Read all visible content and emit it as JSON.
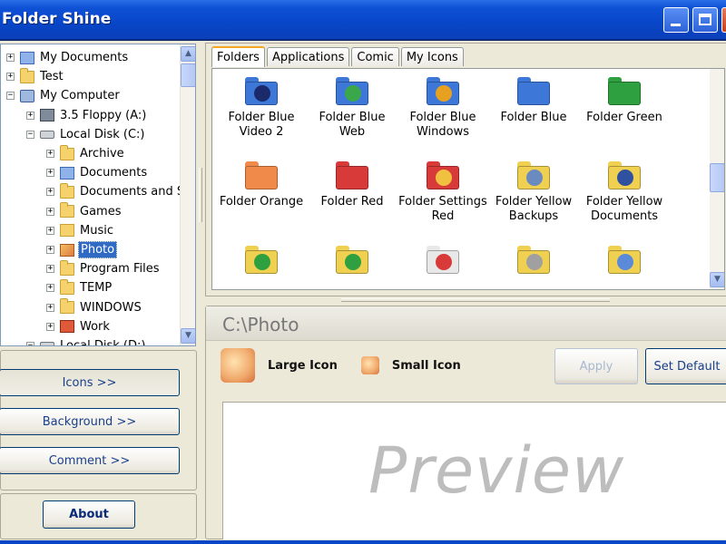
{
  "window": {
    "title": "Folder Shine",
    "minimize_icon": "minimize-icon",
    "maximize_icon": "maximize-icon",
    "close_icon": "close-icon"
  },
  "tree": {
    "items": [
      {
        "label": "My Documents",
        "icon": "documents-folder-icon",
        "expander": "+",
        "level": 0
      },
      {
        "label": "Test",
        "icon": "folder-icon",
        "expander": "+",
        "level": 0
      },
      {
        "label": "My Computer",
        "icon": "computer-icon",
        "expander": "−",
        "level": 0
      },
      {
        "label": "3.5 Floppy (A:)",
        "icon": "floppy-icon",
        "expander": "+",
        "level": 1
      },
      {
        "label": "Local Disk (C:)",
        "icon": "disk-icon",
        "expander": "−",
        "level": 1
      },
      {
        "label": "Archive",
        "icon": "folder-icon",
        "expander": "+",
        "level": 2
      },
      {
        "label": "Documents",
        "icon": "documents-folder-icon",
        "expander": "+",
        "level": 2
      },
      {
        "label": "Documents and S",
        "icon": "folder-icon",
        "expander": "+",
        "level": 2
      },
      {
        "label": "Games",
        "icon": "folder-icon",
        "expander": "+",
        "level": 2
      },
      {
        "label": "Music",
        "icon": "music-folder-icon",
        "expander": "+",
        "level": 2
      },
      {
        "label": "Photo",
        "icon": "photo-folder-icon",
        "expander": "+",
        "level": 2,
        "selected": true
      },
      {
        "label": "Program Files",
        "icon": "folder-icon",
        "expander": "+",
        "level": 2
      },
      {
        "label": "TEMP",
        "icon": "folder-icon",
        "expander": "+",
        "level": 2
      },
      {
        "label": "WINDOWS",
        "icon": "folder-icon",
        "expander": "+",
        "level": 2
      },
      {
        "label": "Work",
        "icon": "work-folder-icon",
        "expander": "+",
        "level": 2
      },
      {
        "label": "Local Disk (D:)",
        "icon": "disk-icon",
        "expander": "−",
        "level": 1
      }
    ],
    "scroll_up_glyph": "▲",
    "scroll_down_glyph": "▼"
  },
  "left_buttons": {
    "icons": "Icons >>",
    "background": "Background >>",
    "comment": "Comment >>",
    "about": "About"
  },
  "tabs": [
    "Folders",
    "Applications",
    "Comic",
    "My Icons"
  ],
  "icon_grid": [
    {
      "label": "Folder Blue Video 2",
      "lines": [
        "Folder Blue",
        "Video 2"
      ],
      "color": "#3d78d8",
      "emb": "#1a2a6a"
    },
    {
      "label": "Folder Blue Web",
      "lines": [
        "Folder Blue",
        "Web"
      ],
      "color": "#3d78d8",
      "emb": "#3aa84a"
    },
    {
      "label": "Folder Blue Windows",
      "lines": [
        "Folder Blue",
        "Windows"
      ],
      "color": "#3d78d8",
      "emb": "#e8a020"
    },
    {
      "label": "Folder Blue",
      "lines": [
        "Folder Blue"
      ],
      "color": "#3d78d8",
      "emb": ""
    },
    {
      "label": "Folder Green",
      "lines": [
        "Folder Green"
      ],
      "color": "#2ea040",
      "emb": ""
    },
    {
      "label": "Folder Orange",
      "lines": [
        "Folder Orange"
      ],
      "color": "#f08a4a",
      "emb": ""
    },
    {
      "label": "Folder Red",
      "lines": [
        "Folder Red"
      ],
      "color": "#d83a3a",
      "emb": ""
    },
    {
      "label": "Folder Settings Red",
      "lines": [
        "Folder Settings",
        "Red"
      ],
      "color": "#d83a3a",
      "emb": "#f0c040"
    },
    {
      "label": "Folder Yellow Backups",
      "lines": [
        "Folder Yellow",
        "Backups"
      ],
      "color": "#f0d050",
      "emb": "#6a8ac0"
    },
    {
      "label": "Folder Yellow Documents",
      "lines": [
        "Folder Yellow",
        "Documents"
      ],
      "color": "#f0d050",
      "emb": "#3050a0"
    },
    {
      "label": "",
      "lines": [],
      "color": "#f0d050",
      "emb": "#2ea040"
    },
    {
      "label": "",
      "lines": [],
      "color": "#f0d050",
      "emb": "#2ea040"
    },
    {
      "label": "",
      "lines": [],
      "color": "#e8e8e8",
      "emb": "#d83a3a"
    },
    {
      "label": "",
      "lines": [],
      "color": "#f0d050",
      "emb": "#a0a0a0"
    },
    {
      "label": "",
      "lines": [],
      "color": "#f0d050",
      "emb": "#5a8ad8"
    }
  ],
  "detail": {
    "path": "C:\\Photo",
    "large_icon_label": "Large Icon",
    "small_icon_label": "Small Icon",
    "apply": "Apply",
    "set_default": "Set Default",
    "preview": "Preview"
  }
}
